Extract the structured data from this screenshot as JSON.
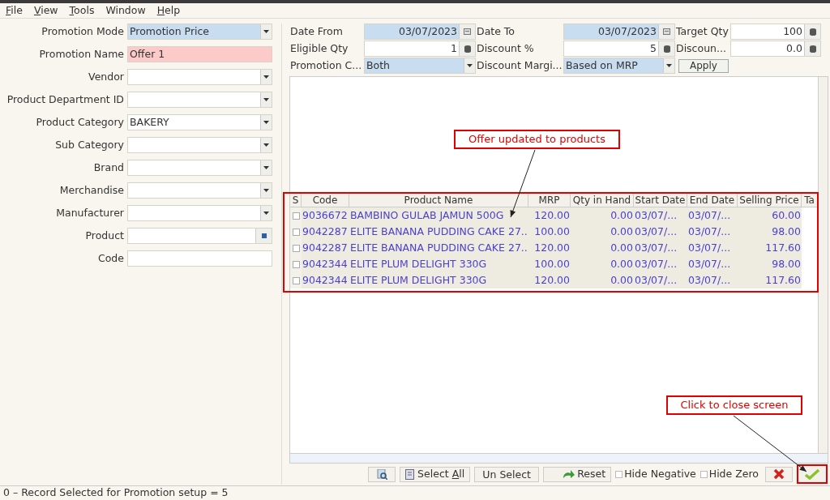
{
  "menu": [
    {
      "accel": "F",
      "rest": "ile"
    },
    {
      "accel": "V",
      "rest": "iew"
    },
    {
      "accel": "T",
      "rest": "ools"
    },
    {
      "before": "Window"
    },
    {
      "accel": "H",
      "rest": "elp"
    }
  ],
  "left_form": [
    {
      "label": "Promotion Mode",
      "kind": "combo",
      "value": "Promotion Price",
      "color": "#c9ddf1"
    },
    {
      "label": "Promotion Name",
      "kind": "text",
      "value": "Offer 1",
      "color": "#fdcaca"
    },
    {
      "label": "Vendor",
      "kind": "combo"
    },
    {
      "label": "Product Department ID",
      "kind": "combo"
    },
    {
      "label": "Product Category",
      "kind": "combo",
      "value": "BAKERY"
    },
    {
      "label": "Sub Category",
      "kind": "combo"
    },
    {
      "label": "Brand",
      "kind": "combo"
    },
    {
      "label": "Merchandise",
      "kind": "combo"
    },
    {
      "label": "Manufacturer",
      "kind": "combo"
    },
    {
      "label": "Product",
      "kind": "lookup"
    },
    {
      "label": "Code",
      "kind": "text"
    }
  ],
  "top_form": [
    {
      "label": "Date From",
      "kind": "date",
      "value": "03/07/2023",
      "color": "#c9ddf1"
    },
    {
      "label": "Date To",
      "kind": "date",
      "value": "03/07/2023",
      "color": "#c9ddf1"
    },
    {
      "label": "Target Qty",
      "kind": "number",
      "value": "100"
    },
    {
      "label": "Eligible Qty",
      "kind": "number",
      "value": "1"
    },
    {
      "label": "Discount %",
      "kind": "number",
      "value": "5"
    },
    {
      "label": "Discoun...",
      "kind": "number",
      "value": "0.0"
    },
    {
      "label": "Promotion C...",
      "kind": "combo",
      "value": "Both",
      "color": "#c9ddf1"
    },
    {
      "label": "Discount Margi...",
      "kind": "combo",
      "value": "Based on MRP",
      "color": "#c9ddf1"
    },
    {
      "label": "Apply",
      "kind": "button"
    }
  ],
  "table": {
    "select_header": "S",
    "columns": [
      "Code",
      "Product Name",
      "MRP",
      "Qty in Hand",
      "Start Date",
      "End Date",
      "Selling Price",
      "Ta"
    ],
    "rows": [
      {
        "checked": false,
        "cells": [
          "9036672",
          "BAMBINO GULAB JAMUN 500G",
          "120.00",
          "0.00",
          "03/07/...",
          "03/07/...",
          "60.00"
        ]
      },
      {
        "checked": false,
        "cells": [
          "9042287",
          "ELITE BANANA PUDDING CAKE 27...",
          "100.00",
          "0.00",
          "03/07/...",
          "03/07/...",
          "98.00"
        ]
      },
      {
        "checked": false,
        "cells": [
          "9042287",
          "ELITE BANANA PUDDING CAKE 27...",
          "120.00",
          "0.00",
          "03/07/...",
          "03/07/...",
          "117.60"
        ]
      },
      {
        "checked": false,
        "cells": [
          "9042344",
          "ELITE PLUM DELIGHT 330G",
          "100.00",
          "0.00",
          "03/07/...",
          "03/07/...",
          "98.00"
        ]
      },
      {
        "checked": false,
        "cells": [
          "9042344",
          "ELITE PLUM DELIGHT 330G",
          "120.00",
          "0.00",
          "03/07/...",
          "03/07/...",
          "117.60"
        ]
      }
    ]
  },
  "toolbar": {
    "select_all": {
      "before": "Select ",
      "accel": "A",
      "rest": "ll"
    },
    "unselect": "Un Select",
    "reset": "Reset",
    "options": [
      {
        "label": "Hide Negative",
        "checked": false
      },
      {
        "label": "Hide Zero",
        "checked": false
      }
    ]
  },
  "status_bar": "0 – Record Selected for Promotion setup = 5",
  "annotations": [
    {
      "text": "Offer updated to products"
    },
    {
      "text": "Click to close screen"
    }
  ]
}
